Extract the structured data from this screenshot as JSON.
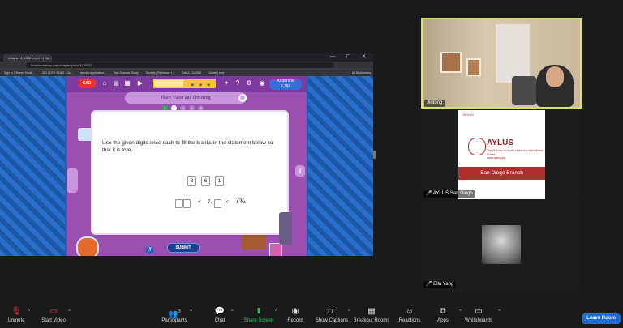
{
  "browser": {
    "tab_title": "Chapter 1 CCM Level 6 | Ga...",
    "window_controls": "— ▢ ✕",
    "url": "beastacademy.com/chapter/place/1/1/50/2",
    "bookmarks": [
      "Sign In | Stanm Stude...",
      "ISD / CPS S1W2 - Go...",
      "mentor.application...",
      "San Science Study",
      "Society | Rainbow H...",
      "ZotLA - ZoOBE",
      "Guide | new",
      "All Bookmarks"
    ]
  },
  "game": {
    "logo": "CAD",
    "profile_name": "Anderson",
    "profile_points": "3,790",
    "title": "Place Value and Ordering",
    "dots": [
      "1",
      "2",
      "3",
      "4",
      "5"
    ],
    "question": "Use the given digits once each to fill the blanks in the statement below so that it is true.",
    "digits": [
      "3",
      "6",
      "1"
    ],
    "lt1": "<",
    "seven": "7.",
    "lt2": "<",
    "tail": "7¾",
    "submit": "SUBMIT",
    "info": "i",
    "refresh": "↺"
  },
  "participants": {
    "tile1_name": "Jintong",
    "tile2_name": "AYLUS San Diego",
    "tile3_name": "Ella Yang"
  },
  "poster": {
    "logo_text": "AYLUS",
    "title": "AYLUS",
    "subtitle": "The Alliance of Youth Leaders in the United States",
    "site": "www.aylus.org",
    "band": "San Diego Branch"
  },
  "toolbar": {
    "unmute": "Unmute",
    "start_video": "Start Video",
    "participants": "Participants",
    "participants_count": "3",
    "chat": "Chat",
    "share_screen": "Share Screen",
    "record": "Record",
    "captions": "Show Captions",
    "breakout": "Breakout Rooms",
    "reactions": "Reactions",
    "apps": "Apps",
    "whiteboards": "Whiteboards",
    "leave": "Leave Room"
  },
  "colors": {
    "share_green": "#1fcb5a",
    "leave_blue": "#1f6bd8",
    "active_speaker": "#d6e36a"
  }
}
